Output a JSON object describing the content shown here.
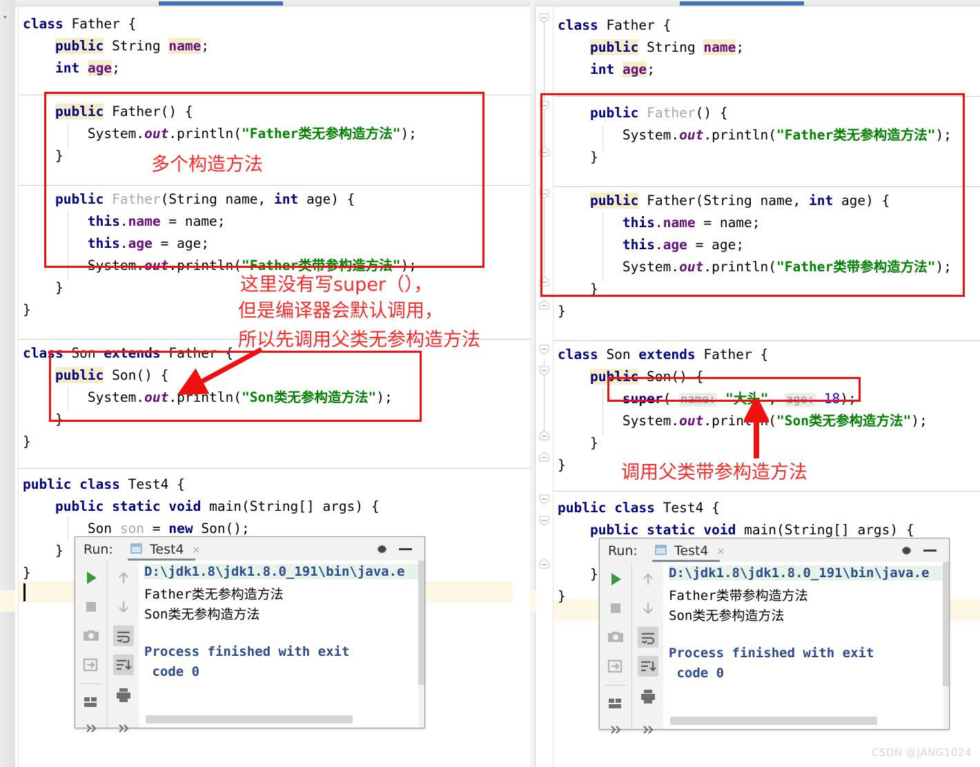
{
  "watermark": "CSDN @JANG1024",
  "left_pane": {
    "name": "left-editor-pane",
    "code_lines": [
      "class Father {",
      "    public String name;",
      "    int age;",
      "",
      "    public Father() {",
      "        System.out.println(\"Father类无参构造方法\");",
      "    }",
      "",
      "    public Father(String name, int age) {",
      "        this.name = name;",
      "        this.age = age;",
      "        System.out.println(\"Father类带参构造方法\");",
      "    }",
      "}",
      "",
      "class Son extends Father {",
      "    public Son() {",
      "        System.out.println(\"Son类无参构造方法\");",
      "    }",
      "}",
      "",
      "public class Test4 {",
      "    public static void main(String[] args) {",
      "        Son son = new Son();",
      "    }",
      "}"
    ],
    "annotations": [
      {
        "name": "multiple-constructors-note",
        "text": "多个构造方法"
      },
      {
        "name": "implicit-super-note",
        "line1": "这里没有写super（），",
        "line2": "但是编译器会默认调用，",
        "line3": "所以先调用父类无参构造方法"
      }
    ],
    "console": {
      "run_label": "Run:",
      "tab_name": "Test4",
      "close_glyph": "×",
      "lines": [
        "D:\\jdk1.8\\jdk1.8.0_191\\bin\\java.e",
        "Father类无参构造方法",
        "Son类无参构造方法",
        "",
        "Process finished with exit",
        " code 0"
      ]
    }
  },
  "right_pane": {
    "name": "right-editor-pane",
    "code_lines": [
      "class Father {",
      "    public String name;",
      "    int age;",
      "",
      "    public Father() {",
      "        System.out.println(\"Father类无参构造方法\");",
      "    }",
      "",
      "    public Father(String name, int age) {",
      "        this.name = name;",
      "        this.age = age;",
      "        System.out.println(\"Father类带参构造方法\");",
      "    }",
      "}",
      "",
      "class Son extends Father {",
      "    public Son() {",
      "        super( name: \"大头\", age: 18);",
      "        System.out.println(\"Son类无参构造方法\");",
      "    }",
      "}",
      "",
      "public class Test4 {",
      "    public static void main(String[] args) {"
    ],
    "param_hints": {
      "name_hint": "name:",
      "age_hint": "age:"
    },
    "super_args": {
      "name_value": "\"大头\"",
      "age_value": "18"
    },
    "annotations": [
      {
        "name": "call-parent-param-constructor-note",
        "text": "调用父类带参构造方法"
      }
    ],
    "console": {
      "run_label": "Run:",
      "tab_name": "Test4",
      "close_glyph": "×",
      "lines": [
        "D:\\jdk1.8\\jdk1.8.0_191\\bin\\java.e",
        "Father类带参构造方法",
        "Son类无参构造方法",
        "",
        "Process finished with exit",
        " code 0"
      ]
    }
  },
  "console_toolbar": {
    "buttons": [
      "rerun-icon",
      "stop-icon",
      "screenshot-icon",
      "export-icon",
      "layout-icon",
      "more-icon"
    ],
    "buttons2": [
      "up-arrow-icon",
      "down-arrow-icon",
      "soft-wrap-icon",
      "scroll-to-end-icon",
      "print-icon",
      "more-icon"
    ]
  },
  "colors": {
    "keyword": "#000080",
    "string": "#008000",
    "field": "#660e7a",
    "number": "#0000ff",
    "annotation_red": "#fb2a2a",
    "box_red": "#f01010",
    "highlight": "#f5ecc8",
    "tab_blue": "#3d72b5"
  }
}
